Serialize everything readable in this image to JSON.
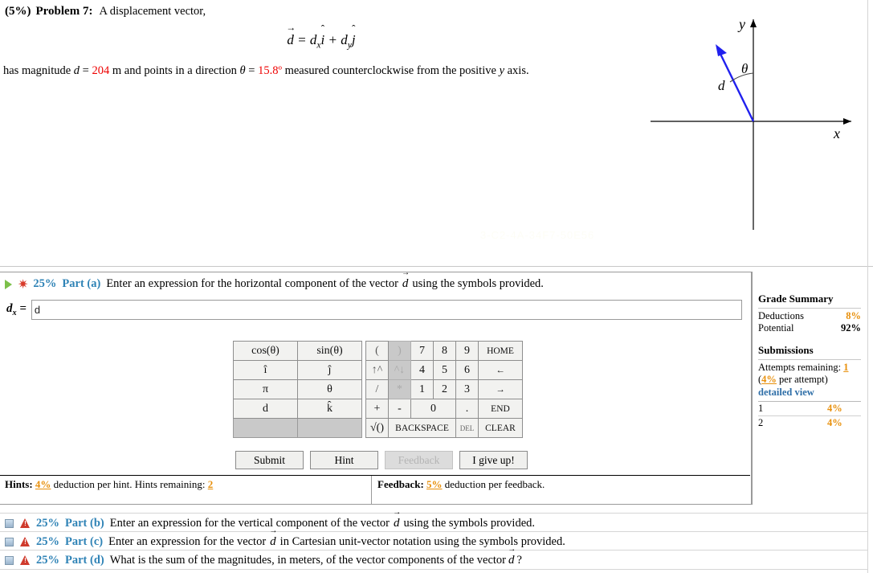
{
  "problem": {
    "weight": "(5%)",
    "number": "Problem 7:",
    "intro": "A displacement vector,",
    "equation": {
      "lhs": "d",
      "rhs_dx": "d",
      "rhs_dx_sub": "x",
      "i_hat": "i",
      "plus": "+",
      "rhs_dy": "d",
      "rhs_dy_sub": "y",
      "j_hat": "j",
      "equals": "="
    },
    "line2_pre": "has magnitude",
    "line2_d": "d",
    "line2_eq1": "=",
    "magnitude": "204",
    "line2_mid": "m and points in a direction",
    "theta_sym": "θ",
    "line2_eq2": "=",
    "angle": "15.8º",
    "line2_post": "measured counterclockwise from the positive",
    "axis": "y",
    "line2_end": "axis."
  },
  "figure": {
    "y_label": "y",
    "x_label": "x",
    "theta_label": "θ",
    "d_label": "d",
    "vector_color": "#2020ee",
    "axis_color": "#000000"
  },
  "part_a": {
    "percent": "25%",
    "label": "Part (a)",
    "prompt_before": "Enter an expression for the horizontal component of the vector",
    "vector_symbol": "d",
    "prompt_after": "using the symbols provided.",
    "answer_label": "d",
    "answer_label_sub": "x",
    "answer_equals": "=",
    "answer_value": "d",
    "answer_placeholder": ""
  },
  "keypad_left": [
    [
      "cos(θ)",
      "sin(θ)"
    ],
    [
      "î",
      "ĵ"
    ],
    [
      "π",
      "θ"
    ],
    [
      "d",
      "k̂"
    ],
    [
      "",
      ""
    ]
  ],
  "keypad_right": {
    "row1": [
      "(",
      ")",
      "7",
      "8",
      "9",
      "HOME"
    ],
    "row2": [
      "↑^",
      "^↓",
      "4",
      "5",
      "6",
      "←"
    ],
    "row3": [
      "/",
      "*",
      "1",
      "2",
      "3",
      "→"
    ],
    "row4": [
      "+",
      "-",
      "0",
      ".",
      "END"
    ],
    "row5": [
      "√()",
      "BACKSPACE",
      "DEL",
      "CLEAR"
    ]
  },
  "buttons": {
    "submit": "Submit",
    "hint": "Hint",
    "feedback": "Feedback",
    "give_up": "I give up!"
  },
  "hints_bar": {
    "hints_label": "Hints:",
    "hints_pct": "4%",
    "hints_text": "deduction per hint. Hints remaining:",
    "hints_remaining": "2",
    "feedback_label": "Feedback:",
    "feedback_pct": "5%",
    "feedback_text": "deduction per feedback."
  },
  "grade_summary": {
    "title": "Grade Summary",
    "deductions_label": "Deductions",
    "deductions_value": "8%",
    "potential_label": "Potential",
    "potential_value": "92%",
    "submissions_title": "Submissions",
    "attempts_label": "Attempts remaining:",
    "attempts_value": "1",
    "per_attempt_pct": "4%",
    "per_attempt_text": "per attempt)",
    "per_attempt_open": "(",
    "detailed_view": "detailed view",
    "rows": [
      {
        "num": "1",
        "pct": "4%"
      },
      {
        "num": "2",
        "pct": "4%"
      }
    ]
  },
  "other_parts": [
    {
      "percent": "25%",
      "label": "Part (b)",
      "prompt_before": "Enter an expression for the vertical component of the vector",
      "vector_symbol": "d",
      "prompt_after": "using the symbols provided."
    },
    {
      "percent": "25%",
      "label": "Part (c)",
      "prompt_before": "Enter an expression for the vector",
      "vector_symbol": "d",
      "prompt_after": "in Cartesian unit-vector notation using the symbols provided."
    },
    {
      "percent": "25%",
      "label": "Part (d)",
      "prompt_before": "What is the sum of the magnitudes, in meters, of the vector components of the vector",
      "vector_symbol": "d",
      "prompt_after": "?"
    }
  ]
}
